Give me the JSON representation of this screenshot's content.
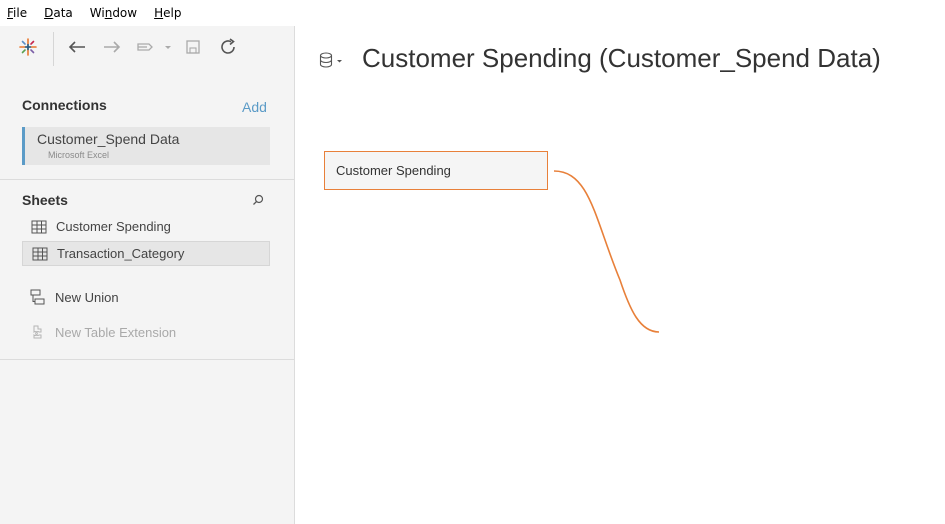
{
  "menu": [
    {
      "label": "File",
      "underline_index": 0
    },
    {
      "label": "Data",
      "underline_index": 0
    },
    {
      "label": "Window",
      "underline_index": 2
    },
    {
      "label": "Help",
      "underline_index": 0
    }
  ],
  "toolbar": {
    "icons": [
      "tableau-logo-icon",
      "back-arrow-icon",
      "forward-arrow-icon",
      "pause-updates-icon",
      "save-icon",
      "refresh-icon"
    ]
  },
  "connections": {
    "title": "Connections",
    "add_label": "Add",
    "items": [
      {
        "name": "Customer_Spend Data",
        "type": "Microsoft Excel"
      }
    ]
  },
  "sheets": {
    "title": "Sheets",
    "items": [
      {
        "label": "Customer Spending",
        "selected": false
      },
      {
        "label": "Transaction_Category",
        "selected": true
      }
    ]
  },
  "actions": {
    "new_union": "New Union",
    "new_table_extension": "New Table Extension"
  },
  "canvas": {
    "title": "Customer Spending (Customer_Spend Data)",
    "tables": [
      {
        "label": "Customer Spending"
      }
    ]
  },
  "colors": {
    "accent_blue": "#5b9bc7",
    "accent_orange": "#e8803a",
    "sidebar_bg": "#f4f4f4"
  }
}
